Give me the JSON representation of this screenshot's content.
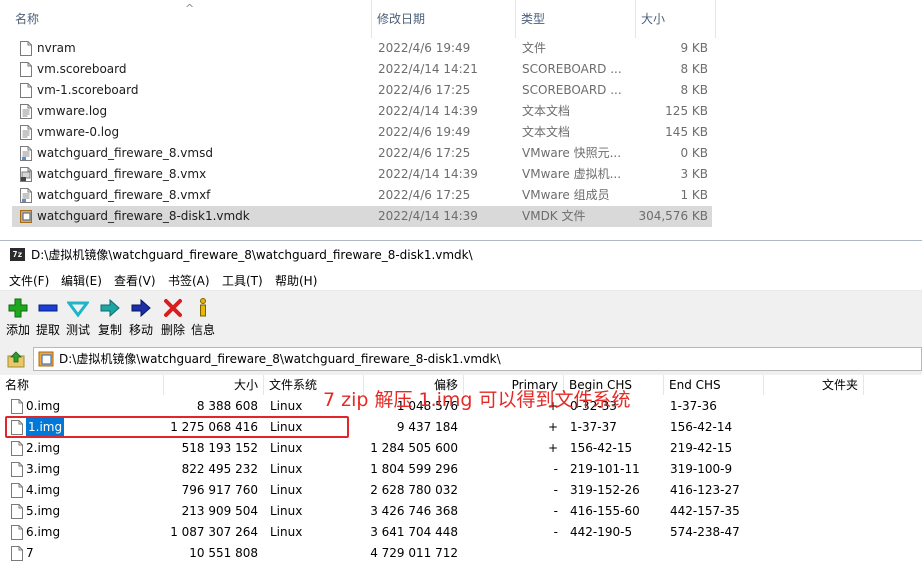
{
  "explorer": {
    "columns": {
      "name": "名称",
      "modified": "修改日期",
      "type": "类型",
      "size": "大小"
    },
    "files": [
      {
        "name": "nvram",
        "modified": "2022/4/6 19:49",
        "type": "文件",
        "size": "9 KB",
        "icon": "file-icon"
      },
      {
        "name": "vm.scoreboard",
        "modified": "2022/4/14 14:21",
        "type": "SCOREBOARD ...",
        "size": "8 KB",
        "icon": "file-icon"
      },
      {
        "name": "vm-1.scoreboard",
        "modified": "2022/4/6 17:25",
        "type": "SCOREBOARD ...",
        "size": "8 KB",
        "icon": "file-icon"
      },
      {
        "name": "vmware.log",
        "modified": "2022/4/14 14:39",
        "type": "文本文档",
        "size": "125 KB",
        "icon": "text-file-icon"
      },
      {
        "name": "vmware-0.log",
        "modified": "2022/4/6 19:49",
        "type": "文本文档",
        "size": "145 KB",
        "icon": "text-file-icon"
      },
      {
        "name": "watchguard_fireware_8.vmsd",
        "modified": "2022/4/6 17:25",
        "type": "VMware 快照元...",
        "size": "0 KB",
        "icon": "vmware-file-icon"
      },
      {
        "name": "watchguard_fireware_8.vmx",
        "modified": "2022/4/14 14:39",
        "type": "VMware 虚拟机...",
        "size": "3 KB",
        "icon": "vmware-config-icon"
      },
      {
        "name": "watchguard_fireware_8.vmxf",
        "modified": "2022/4/6 17:25",
        "type": "VMware 组成员",
        "size": "1 KB",
        "icon": "vmware-file-icon"
      },
      {
        "name": "watchguard_fireware_8-disk1.vmdk",
        "modified": "2022/4/14 14:39",
        "type": "VMDK 文件",
        "size": "304,576 KB",
        "icon": "vmdk-icon",
        "selected": true
      }
    ]
  },
  "sevenzip": {
    "title": "D:\\虚拟机镜像\\watchguard_fireware_8\\watchguard_fireware_8-disk1.vmdk\\",
    "title_icon": "7z",
    "menu": [
      "文件(F)",
      "编辑(E)",
      "查看(V)",
      "书签(A)",
      "工具(T)",
      "帮助(H)"
    ],
    "toolbar": [
      {
        "label": "添加",
        "icon": "add-icon",
        "color": "#1fa81f"
      },
      {
        "label": "提取",
        "icon": "extract-icon",
        "color": "#1a3fd6"
      },
      {
        "label": "测试",
        "icon": "test-icon",
        "color": "#1fb5c8"
      },
      {
        "label": "复制",
        "icon": "copy-icon",
        "color": "#1ea5a5"
      },
      {
        "label": "移动",
        "icon": "move-icon",
        "color": "#1a2fa8"
      },
      {
        "label": "删除",
        "icon": "delete-icon",
        "color": "#d81e1e"
      },
      {
        "label": "信息",
        "icon": "info-icon",
        "color": "#e6b800"
      }
    ],
    "address": "D:\\虚拟机镜像\\watchguard_fireware_8\\watchguard_fireware_8-disk1.vmdk\\",
    "columns": {
      "name": "名称",
      "size": "大小",
      "fs": "文件系统",
      "offset": "偏移",
      "primary": "Primary",
      "begin_chs": "Begin CHS",
      "end_chs": "End CHS",
      "folder": "文件夹"
    },
    "rows": [
      {
        "name": "0.img",
        "size": "8 388 608",
        "fs": "Linux",
        "offset": "1 048 576",
        "primary": "+",
        "begin": "0-32-33",
        "end": "1-37-36"
      },
      {
        "name": "1.img",
        "size": "1 275 068 416",
        "fs": "Linux",
        "offset": "9 437 184",
        "primary": "+",
        "begin": "1-37-37",
        "end": "156-42-14",
        "selected": true
      },
      {
        "name": "2.img",
        "size": "518 193 152",
        "fs": "Linux",
        "offset": "1 284 505 600",
        "primary": "+",
        "begin": "156-42-15",
        "end": "219-42-15"
      },
      {
        "name": "3.img",
        "size": "822 495 232",
        "fs": "Linux",
        "offset": "1 804 599 296",
        "primary": "-",
        "begin": "219-101-11",
        "end": "319-100-9"
      },
      {
        "name": "4.img",
        "size": "796 917 760",
        "fs": "Linux",
        "offset": "2 628 780 032",
        "primary": "-",
        "begin": "319-152-26",
        "end": "416-123-27"
      },
      {
        "name": "5.img",
        "size": "213 909 504",
        "fs": "Linux",
        "offset": "3 426 746 368",
        "primary": "-",
        "begin": "416-155-60",
        "end": "442-157-35"
      },
      {
        "name": "6.img",
        "size": "1 087 307 264",
        "fs": "Linux",
        "offset": "3 641 704 448",
        "primary": "-",
        "begin": "442-190-5",
        "end": "574-238-47"
      },
      {
        "name": "7",
        "size": "10 551 808",
        "fs": "",
        "offset": "4 729 011 712",
        "primary": "",
        "begin": "",
        "end": ""
      }
    ]
  },
  "annotation": {
    "text": "7 zip 解压 1.img 可以得到文件系统",
    "color": "#e52a25"
  }
}
